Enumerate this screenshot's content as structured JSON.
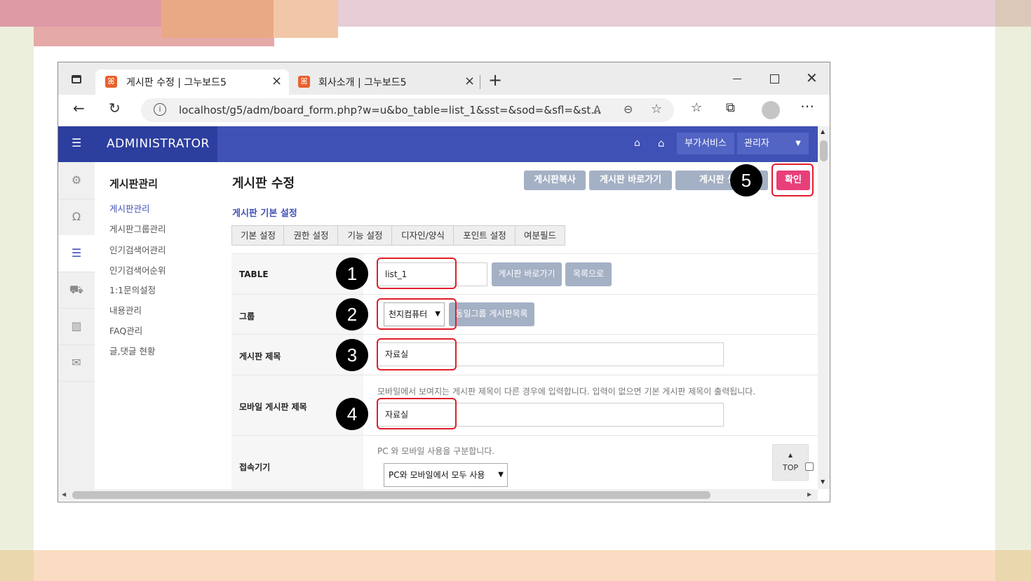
{
  "browser": {
    "tabs": [
      {
        "title": "게시판 수정 | 그누보드5",
        "close": "×"
      },
      {
        "title": "회사소개 | 그누보드5",
        "close": "×"
      }
    ],
    "new_tab": "+",
    "url": "localhost/g5/adm/board_form.php?w=u&bo_table=list_1&sst=&sod=&sfl=&st..."
  },
  "header": {
    "brand": "ADMINISTRATOR",
    "service_button": "부가서비스",
    "admin_button": "관리자"
  },
  "submenu": {
    "title": "게시판관리",
    "items": [
      "게시판관리",
      "게시판그룹관리",
      "인기검색어관리",
      "인기검색어순위",
      "1:1문의설정",
      "내용관리",
      "FAQ관리",
      "글,댓글 현황"
    ]
  },
  "main": {
    "title": "게시판 수정",
    "actions": {
      "copy": "게시판복사",
      "go": "게시판 바로가기",
      "thumb": "게시판 썸네",
      "confirm": "확인"
    },
    "section_title": "게시판 기본 설정",
    "tabs": [
      "기본 설정",
      "권한 설정",
      "기능 설정",
      "디자인/양식",
      "포인트 설정",
      "여분필드"
    ],
    "rows": {
      "table": {
        "label": "TABLE",
        "value": "list_1",
        "btn_go": "게시판 바로가기",
        "btn_list": "목록으로"
      },
      "group": {
        "label": "그룹",
        "value": "천지컴퓨터",
        "btn_same": "동일그룹 게시판목록"
      },
      "subject": {
        "label": "게시판 제목",
        "value": "자료실"
      },
      "mobile_subject": {
        "label": "모바일 게시판 제목",
        "help": "모바일에서 보여지는 게시판 제목이 다른 경우에 입력합니다. 입력이 없으면 기본 게시판 제목이 출력됩니다.",
        "value": "자료실"
      },
      "device": {
        "label": "접속기기",
        "help": "PC 와 모바일 사용을 구분합니다.",
        "value": "PC와 모바일에서 모두 사용"
      }
    },
    "top_button": "TOP"
  },
  "markers": [
    "1",
    "2",
    "3",
    "4",
    "5"
  ],
  "colors": {
    "nav": "#3f51b5",
    "brand": "#2c3e9e",
    "confirm": "#e83e7a",
    "marker_outline": "#e01e2c"
  }
}
